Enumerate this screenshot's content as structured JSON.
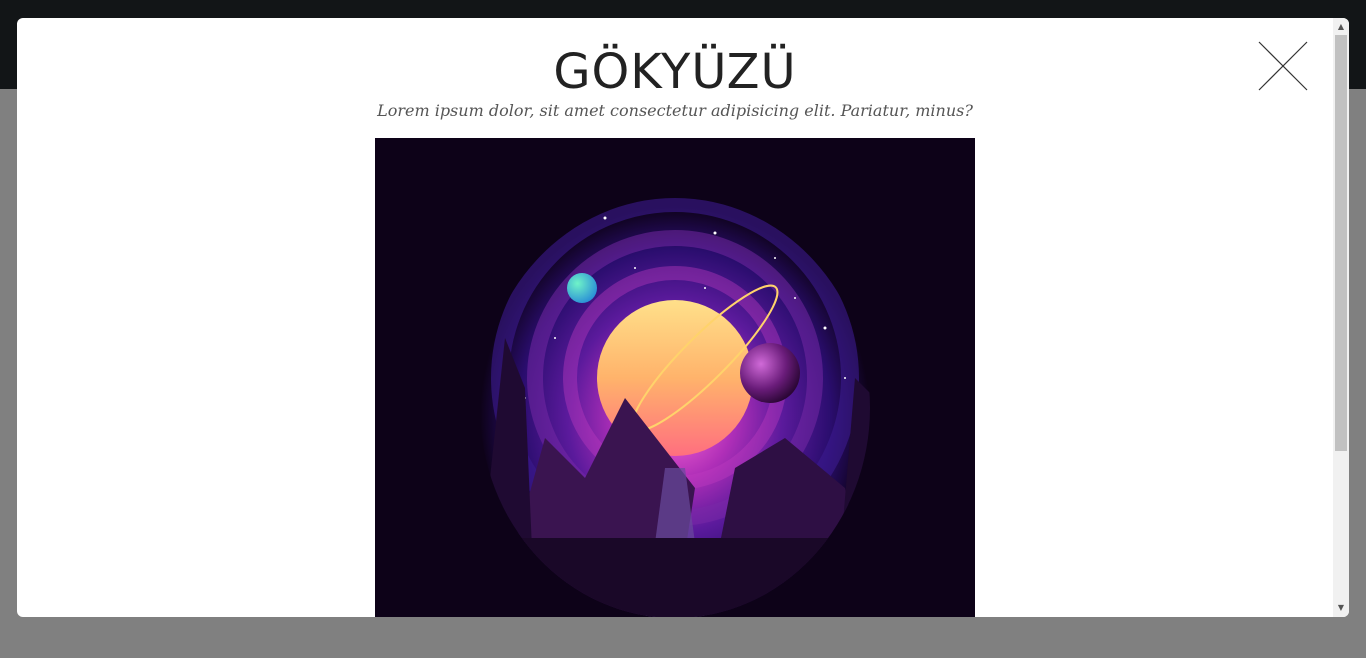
{
  "modal": {
    "title": "GÖKYÜZÜ",
    "subtitle": "Lorem ipsum dolor, sit amet consectetur adipisicing elit. Pariatur, minus?",
    "close_icon": "close-icon",
    "image_alt": "synthwave space landscape illustration"
  },
  "scrollbar": {
    "up_arrow": "▲",
    "down_arrow": "▼"
  },
  "colors": {
    "overlay": "#808080",
    "topbar": "#121517",
    "modal_bg": "#ffffff",
    "image_bg": "#0d0218"
  }
}
